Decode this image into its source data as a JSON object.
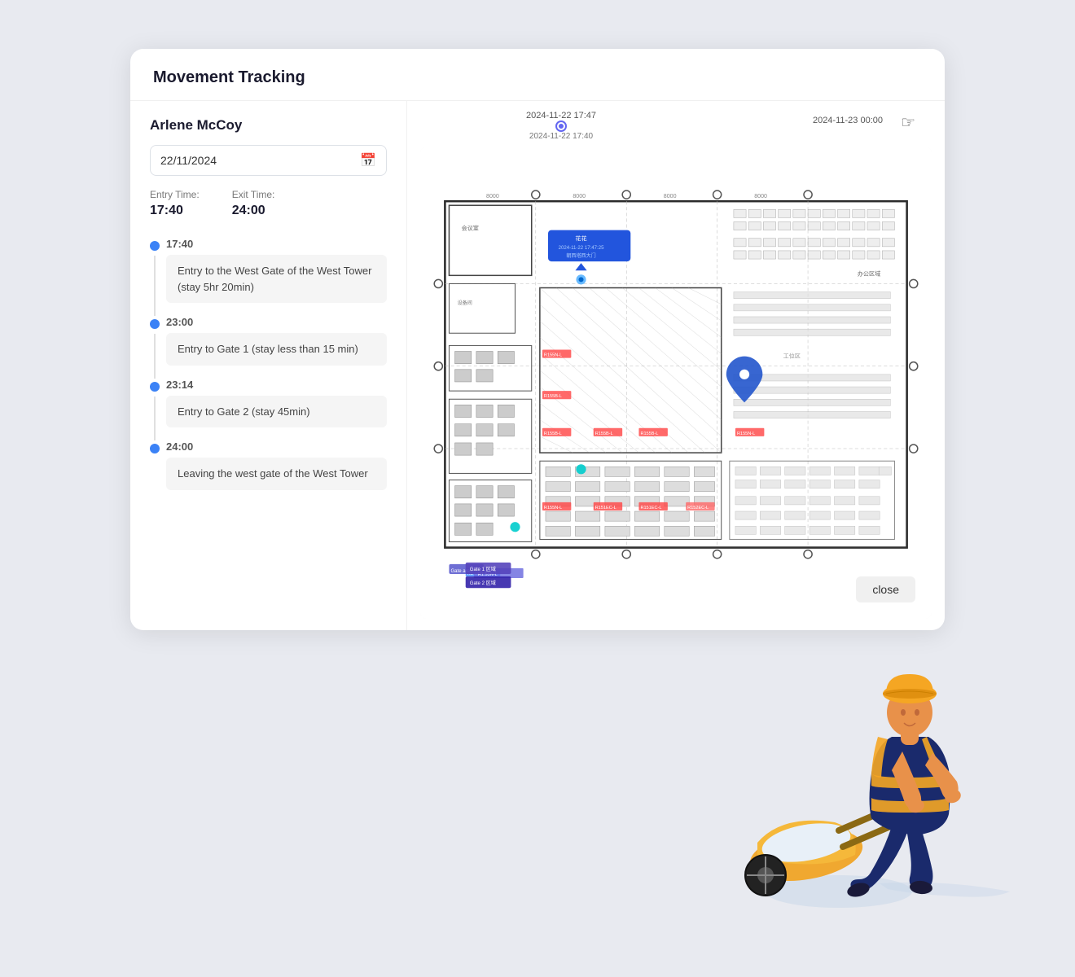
{
  "page": {
    "title": "Movement Tracking",
    "card": {
      "person_name": "Arlene McCoy",
      "date": "22/11/2024",
      "date_placeholder": "22/11/2024",
      "entry_time_label": "Entry Time:",
      "entry_time": "17:40",
      "exit_time_label": "Exit Time:",
      "exit_time": "24:00"
    },
    "timeline": [
      {
        "time": "17:40",
        "description": "Entry to the West Gate of the West Tower (stay 5hr 20min)"
      },
      {
        "time": "23:00",
        "description": "Entry to Gate 1 (stay less than 15 min)"
      },
      {
        "time": "23:14",
        "description": "Entry to Gate 2 (stay 45min)"
      },
      {
        "time": "24:00",
        "description": "Leaving the west gate of the West Tower"
      }
    ],
    "map": {
      "timestamp_left": "2024-11-22 17:47",
      "timestamp_left_sub": "2024-11-22 17:40",
      "timestamp_right": "2024-11-23 00:00",
      "tooltip_title": "花花",
      "tooltip_time": "2024-11-22 17:47:25",
      "tooltip_sub": "朝西塔西大门"
    },
    "close_button": "close"
  }
}
